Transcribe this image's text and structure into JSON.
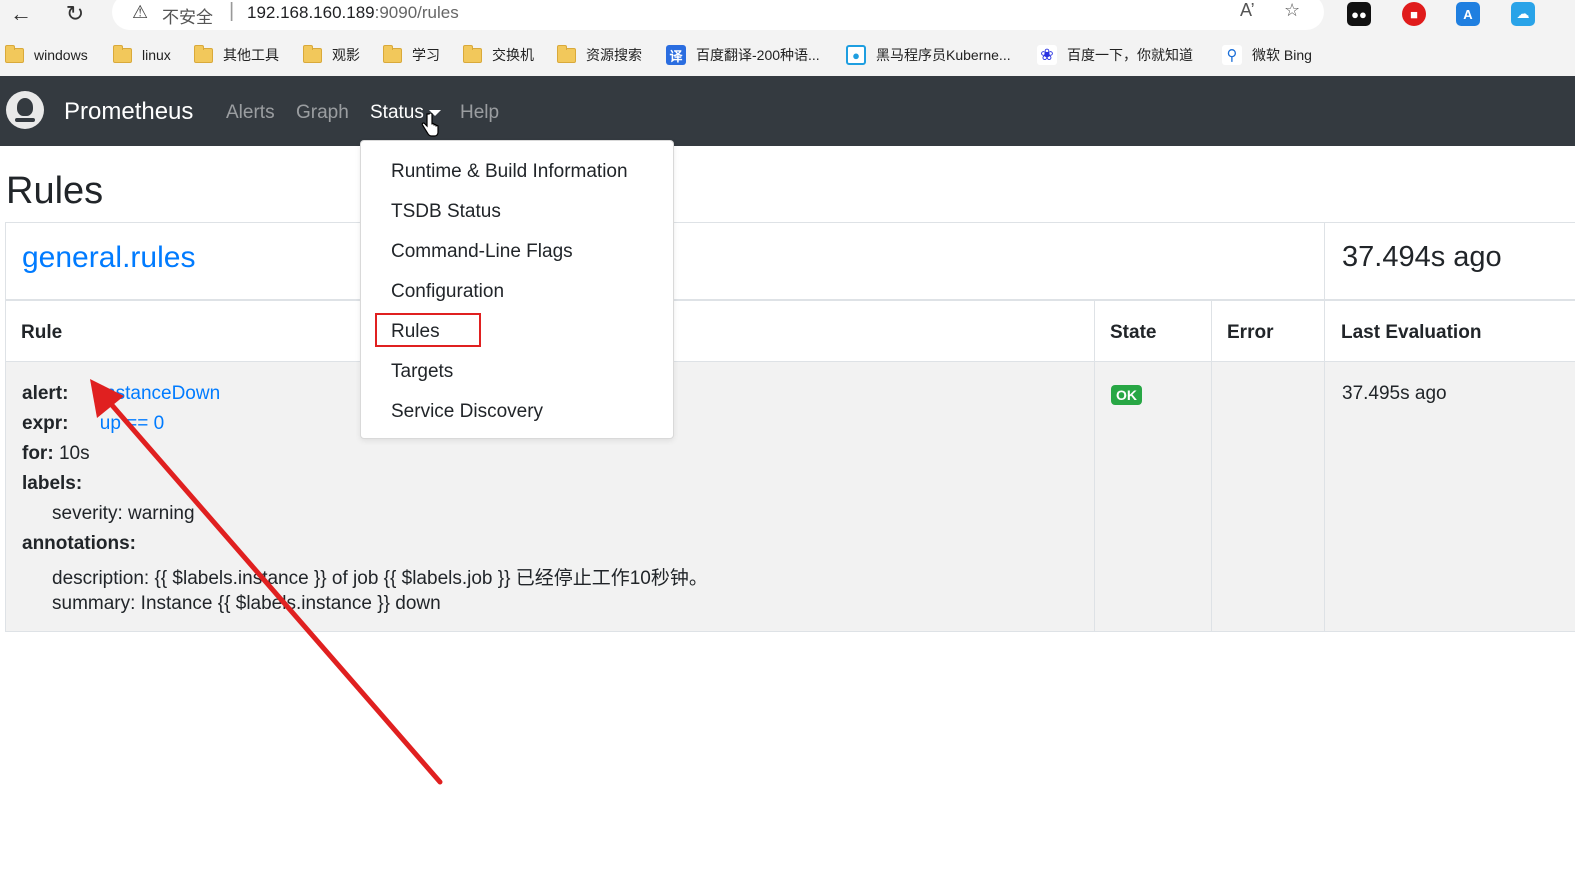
{
  "browser": {
    "insecure_label": "不安全",
    "separator": "|",
    "url_host": "192.168.160.189",
    "url_path": ":9090/rules"
  },
  "bookmarks": [
    {
      "label": "windows",
      "icon": "folder-icon"
    },
    {
      "label": "linux",
      "icon": "folder-icon"
    },
    {
      "label": "其他工具",
      "icon": "folder-icon"
    },
    {
      "label": "观影",
      "icon": "folder-icon"
    },
    {
      "label": "学习",
      "icon": "folder-icon"
    },
    {
      "label": "交换机",
      "icon": "folder-icon"
    },
    {
      "label": "资源搜索",
      "icon": "folder-icon"
    },
    {
      "label": "百度翻译-200种语...",
      "icon": "translate-icon"
    },
    {
      "label": "黑马程序员Kuberne...",
      "icon": "bilibili-icon"
    },
    {
      "label": "百度一下，你就知道",
      "icon": "baidu-icon"
    },
    {
      "label": "微软 Bing",
      "icon": "search-icon"
    }
  ],
  "navbar": {
    "brand": "Prometheus",
    "links": [
      "Alerts",
      "Graph",
      "Status",
      "Help"
    ]
  },
  "dropdown": {
    "items": [
      "Runtime & Build Information",
      "TSDB Status",
      "Command-Line Flags",
      "Configuration",
      "Rules",
      "Targets",
      "Service Discovery"
    ]
  },
  "page": {
    "title": "Rules",
    "group": {
      "name": "general.rules",
      "last_eval": "37.494s ago"
    },
    "columns": [
      "Rule",
      "State",
      "Error",
      "Last Evaluation"
    ],
    "rule": {
      "alert_key": "alert:",
      "alert_value": "InstanceDown",
      "expr_key": "expr:",
      "expr_value": "up == 0",
      "for_key": "for:",
      "for_value": "10s",
      "labels_key": "labels:",
      "label_line": "severity: warning",
      "annotations_key": "annotations:",
      "description_line": "description: {{ $labels.instance }} of job {{ $labels.job }} 已经停止工作10秒钟。",
      "summary_line": "summary: Instance {{ $labels.instance }} down",
      "state": "OK",
      "error": "",
      "last_eval": "37.495s ago"
    }
  },
  "colors": {
    "navbar_bg": "#343a40",
    "link_blue": "#007bff",
    "ok_green": "#28a745",
    "annotation_red": "#e02020"
  }
}
